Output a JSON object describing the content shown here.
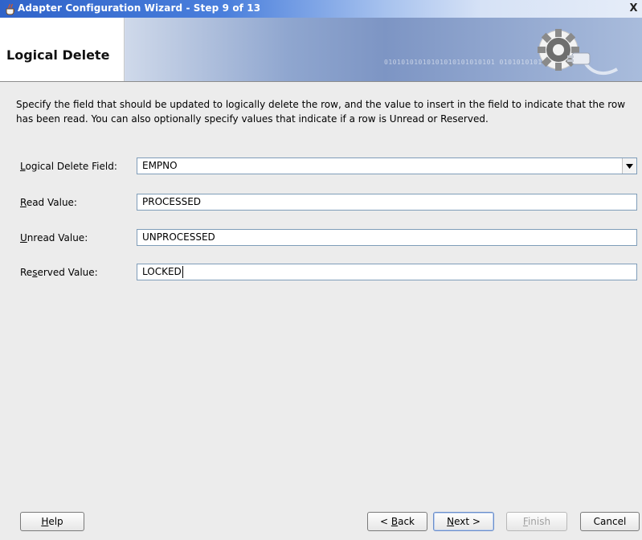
{
  "window": {
    "title": "Adapter Configuration Wizard - Step 9 of 13",
    "close_glyph": "X"
  },
  "banner": {
    "heading": "Logical Delete",
    "binary_text": "01010101010101010101010101 0101010101010"
  },
  "description": "Specify the field that should be updated to logically delete the row, and the value to insert in the field to indicate that the row has been read.  You can also optionally specify values that indicate if a row is Unread or Reserved.",
  "form": {
    "logical_delete_field": {
      "label_mnemonic": "L",
      "label_rest": "ogical Delete Field:",
      "value": "EMPNO"
    },
    "read_value": {
      "label_mnemonic": "R",
      "label_rest": "ead Value:",
      "value": "PROCESSED"
    },
    "unread_value": {
      "label_mnemonic": "U",
      "label_rest": "nread Value:",
      "value": "UNPROCESSED"
    },
    "reserved_value": {
      "label_prefix": "Re",
      "label_mnemonic": "s",
      "label_rest": "erved Value:",
      "value": "LOCKED"
    }
  },
  "buttons": {
    "help": {
      "mnemonic": "H",
      "rest": "elp"
    },
    "back": {
      "prefix": "< ",
      "mnemonic": "B",
      "rest": "ack"
    },
    "next": {
      "mnemonic": "N",
      "rest": "ext >"
    },
    "finish": {
      "mnemonic": "F",
      "rest": "inish"
    },
    "cancel": {
      "label": "Cancel"
    }
  },
  "icons": {
    "app": "java-cup-icon",
    "close": "close-icon",
    "banner": "gear-plug-icon",
    "dropdown": "chevron-down-icon"
  }
}
